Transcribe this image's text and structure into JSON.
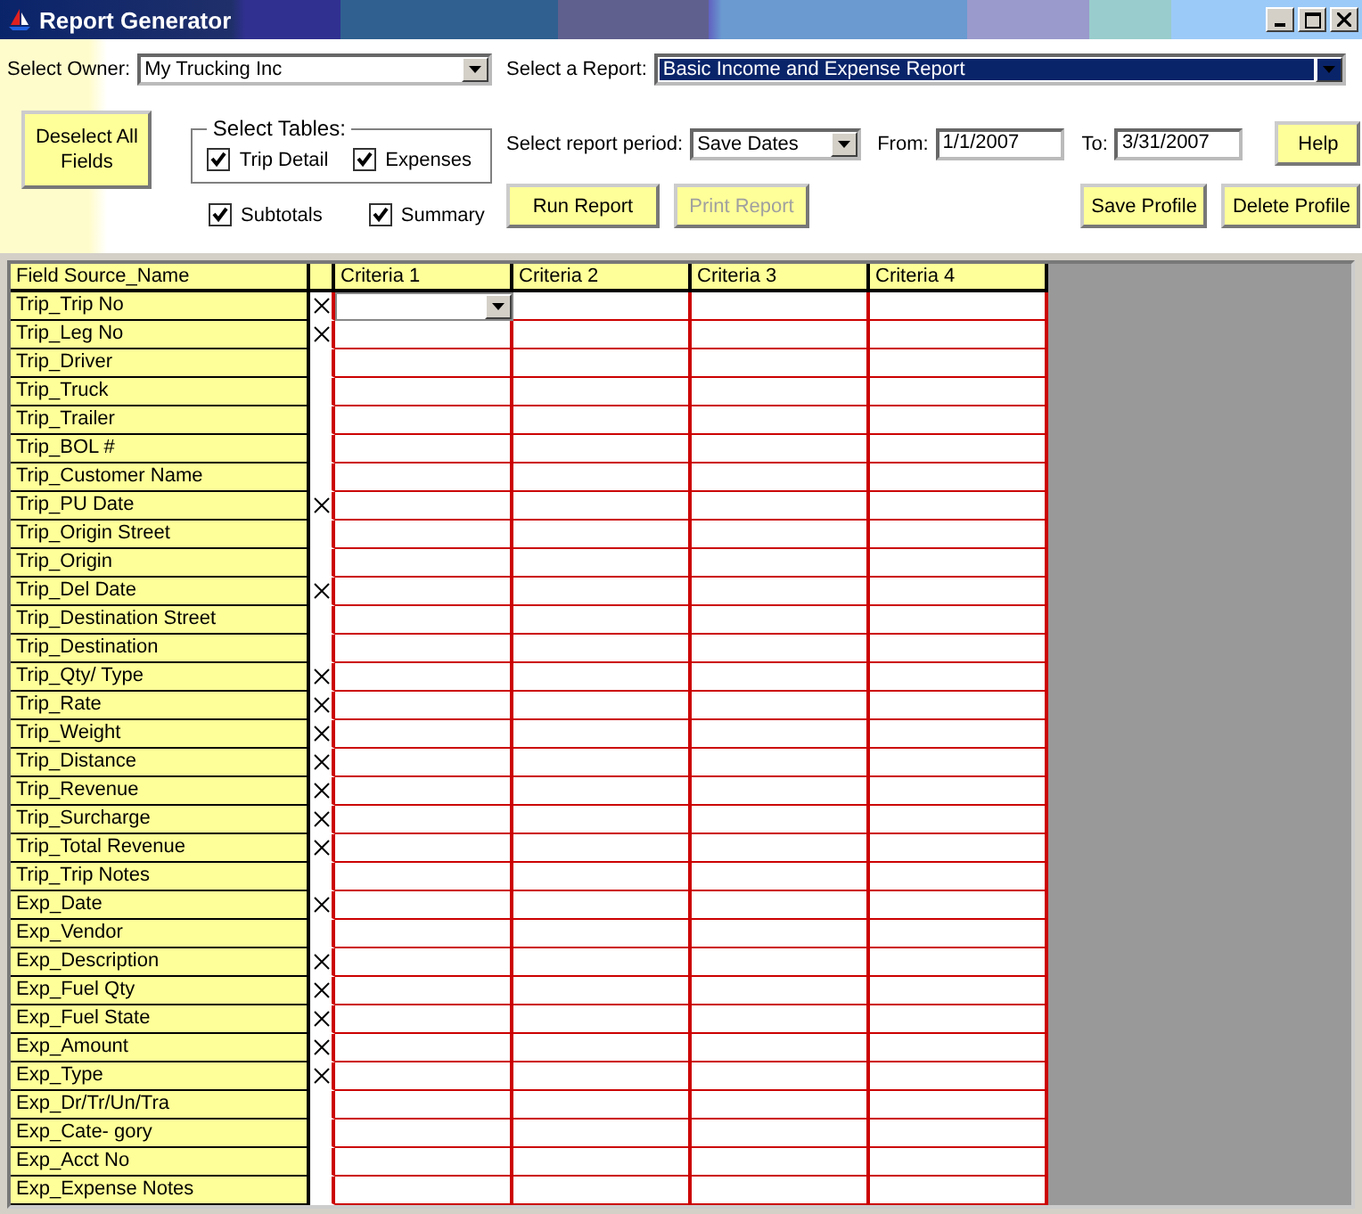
{
  "window": {
    "title": "Report Generator"
  },
  "owner": {
    "label": "Select Owner:",
    "value": "My Trucking Inc"
  },
  "report": {
    "label": "Select a Report:",
    "value": "Basic Income and Expense Report",
    "selected": true
  },
  "deselect_button": {
    "label": "Deselect All Fields"
  },
  "tables": {
    "title": "Select Tables:",
    "options": [
      {
        "label": "Trip Detail",
        "checked": true
      },
      {
        "label": "Expenses",
        "checked": true
      }
    ]
  },
  "extras": [
    {
      "label": "Subtotals",
      "checked": true
    },
    {
      "label": "Summary",
      "checked": true
    }
  ],
  "period": {
    "label": "Select report period:",
    "value": "Save Dates",
    "from_label": "From:",
    "from": "1/1/2007",
    "to_label": "To:",
    "to": "3/31/2007"
  },
  "help_button": {
    "label": "Help"
  },
  "actions": [
    {
      "label": "Run Report",
      "disabled": false
    },
    {
      "label": "Print Report",
      "disabled": true
    }
  ],
  "profile_buttons": [
    {
      "label": "Save Profile"
    },
    {
      "label": "Delete Profile"
    }
  ],
  "table": {
    "columns": [
      "Field Source_Name",
      "Criteria 1",
      "Criteria 2",
      "Criteria 3",
      "Criteria 4"
    ],
    "rows": [
      {
        "name": "Trip_Trip No",
        "included": true,
        "editing": true
      },
      {
        "name": "Trip_Leg No",
        "included": true,
        "editing": false
      },
      {
        "name": "Trip_Driver",
        "included": false,
        "editing": false
      },
      {
        "name": "Trip_Truck",
        "included": false,
        "editing": false
      },
      {
        "name": "Trip_Trailer",
        "included": false,
        "editing": false
      },
      {
        "name": "Trip_BOL #",
        "included": false,
        "editing": false
      },
      {
        "name": "Trip_Customer Name",
        "included": false,
        "editing": false
      },
      {
        "name": "Trip_PU Date",
        "included": true,
        "editing": false
      },
      {
        "name": "Trip_Origin Street",
        "included": false,
        "editing": false
      },
      {
        "name": "Trip_Origin",
        "included": false,
        "editing": false
      },
      {
        "name": "Trip_Del Date",
        "included": true,
        "editing": false
      },
      {
        "name": "Trip_Destination Street",
        "included": false,
        "editing": false
      },
      {
        "name": "Trip_Destination",
        "included": false,
        "editing": false
      },
      {
        "name": "Trip_Qty/ Type",
        "included": true,
        "editing": false
      },
      {
        "name": "Trip_Rate",
        "included": true,
        "editing": false
      },
      {
        "name": "Trip_Weight",
        "included": true,
        "editing": false
      },
      {
        "name": "Trip_Distance",
        "included": true,
        "editing": false
      },
      {
        "name": "Trip_Revenue",
        "included": true,
        "editing": false
      },
      {
        "name": "Trip_Surcharge",
        "included": true,
        "editing": false
      },
      {
        "name": "Trip_Total Revenue",
        "included": true,
        "editing": false
      },
      {
        "name": "Trip_Trip Notes",
        "included": false,
        "editing": false
      },
      {
        "name": "Exp_Date",
        "included": true,
        "editing": false
      },
      {
        "name": "Exp_Vendor",
        "included": false,
        "editing": false
      },
      {
        "name": "Exp_Description",
        "included": true,
        "editing": false
      },
      {
        "name": "Exp_Fuel Qty",
        "included": true,
        "editing": false
      },
      {
        "name": "Exp_Fuel State",
        "included": true,
        "editing": false
      },
      {
        "name": "Exp_Amount",
        "included": true,
        "editing": false
      },
      {
        "name": "Exp_Type",
        "included": true,
        "editing": false
      },
      {
        "name": "Exp_Dr/Tr/Un/Tra",
        "included": false,
        "editing": false
      },
      {
        "name": "Exp_Cate- gory",
        "included": false,
        "editing": false
      },
      {
        "name": "Exp_Acct No",
        "included": false,
        "editing": false
      },
      {
        "name": "Exp_Expense Notes",
        "included": false,
        "editing": false
      }
    ]
  }
}
